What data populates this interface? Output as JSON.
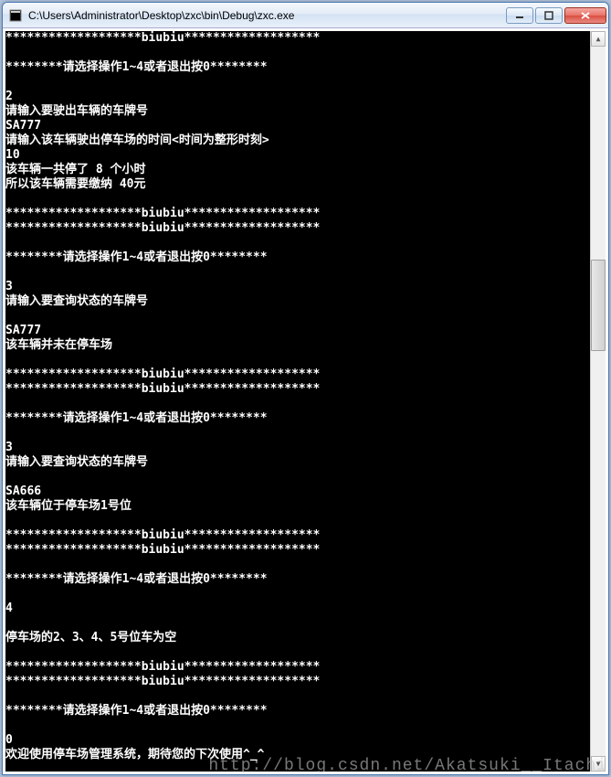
{
  "window": {
    "title": "C:\\Users\\Administrator\\Desktop\\zxc\\bin\\Debug\\zxc.exe"
  },
  "console": {
    "lines": [
      "*******************biubiu*******************",
      "",
      "********请选择操作1~4或者退出按0********",
      "",
      "2",
      "请输入要驶出车辆的车牌号",
      "SA777",
      "请输入该车辆驶出停车场的时间<时间为整形时刻>",
      "10",
      "该车辆一共停了 8 个小时",
      "所以该车辆需要缴纳 40元",
      "",
      "*******************biubiu*******************",
      "*******************biubiu*******************",
      "",
      "********请选择操作1~4或者退出按0********",
      "",
      "3",
      "请输入要查询状态的车牌号",
      "",
      "SA777",
      "该车辆并未在停车场",
      "",
      "*******************biubiu*******************",
      "*******************biubiu*******************",
      "",
      "********请选择操作1~4或者退出按0********",
      "",
      "3",
      "请输入要查询状态的车牌号",
      "",
      "SA666",
      "该车辆位于停车场1号位",
      "",
      "*******************biubiu*******************",
      "*******************biubiu*******************",
      "",
      "********请选择操作1~4或者退出按0********",
      "",
      "4",
      "",
      "停车场的2、3、4、5号位车为空",
      "",
      "*******************biubiu*******************",
      "*******************biubiu*******************",
      "",
      "********请选择操作1~4或者退出按0********",
      "",
      "0",
      "欢迎使用停车场管理系统，期待您的下次使用^_^"
    ]
  },
  "watermark": "http://blog.csdn.net/Akatsuki__Itachi"
}
